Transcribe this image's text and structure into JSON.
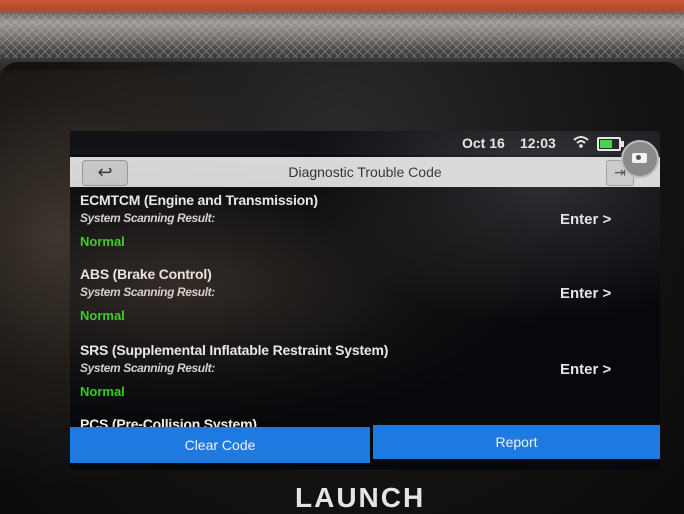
{
  "status_bar": {
    "date": "Oct 16",
    "time": "12:03"
  },
  "header": {
    "back_icon": "↩",
    "title": "Diagnostic Trouble Code",
    "exit_icon": "⇥"
  },
  "systems": [
    {
      "name": "ECMTCM (Engine and Transmission)",
      "scan_label": "System Scanning Result:",
      "result": "Normal",
      "action": "Enter >"
    },
    {
      "name": "ABS (Brake Control)",
      "scan_label": "System Scanning Result:",
      "result": "Normal",
      "action": "Enter >"
    },
    {
      "name": "SRS (Supplemental Inflatable Restraint System)",
      "scan_label": "System Scanning Result:",
      "result": "Normal",
      "action": "Enter >"
    },
    {
      "name": "PCS (Pre-Collision System)"
    }
  ],
  "bottom_bar": {
    "clear_code_label": "Clear Code",
    "report_label": "Report"
  },
  "device": {
    "brand": "LAUNCH"
  },
  "colors": {
    "result_ok": "#2fd11f",
    "button_blue": "#1e7ae0",
    "header_bg": "#d9dadb"
  }
}
